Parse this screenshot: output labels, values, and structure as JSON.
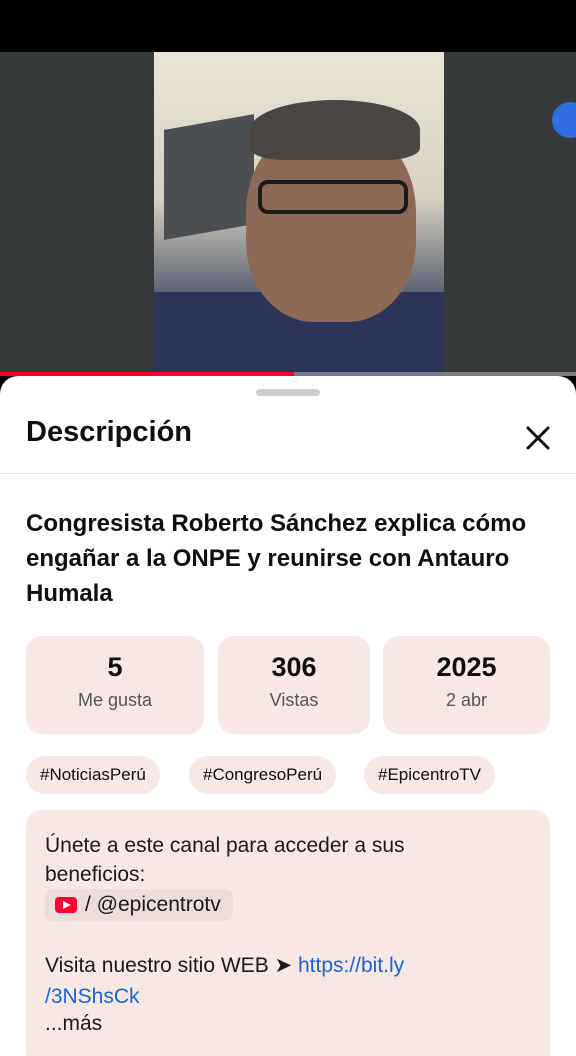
{
  "video": {
    "progress": 0.51
  },
  "sheet": {
    "title": "Descripción",
    "close_icon": "close-icon"
  },
  "video_title": "Congresista Roberto Sánchez explica cómo engañar a la ONPE y reunirse con Antauro Humala",
  "stats": [
    {
      "value": "5",
      "label": "Me gusta"
    },
    {
      "value": "306",
      "label": "Vistas"
    },
    {
      "value": "2025",
      "label": "2 abr"
    }
  ],
  "hashtags": [
    "#NoticiasPerú",
    "#CongresoPerú",
    "#EpicentroTV"
  ],
  "description": {
    "line1": "Únete a este canal para acceder a sus",
    "line2": "beneficios:",
    "chip_icon": "youtube-icon",
    "chip_text": "/ @epicentrotv",
    "visit_text": "Visita nuestro sitio WEB ➤ ",
    "link_line1": "https://bit.ly",
    "link_line2": "/3NShsCk",
    "more": "...más"
  },
  "colors": {
    "accent": "#ff0033",
    "link": "#1565d8",
    "card_bg": "#f8e8e5"
  }
}
